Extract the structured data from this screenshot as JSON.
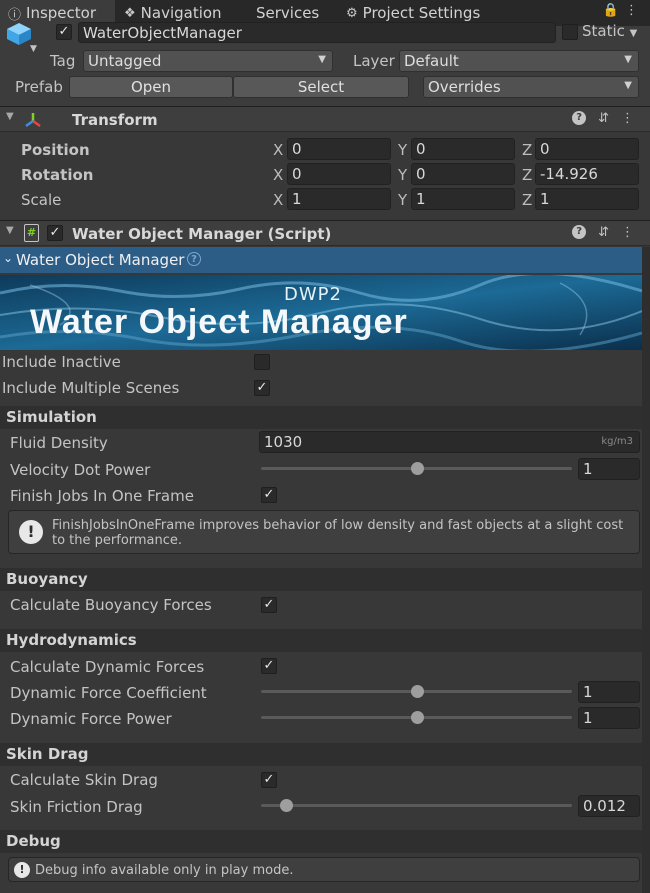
{
  "tabs": [
    {
      "label": "Inspector",
      "icon": "info-icon"
    },
    {
      "label": "Navigation",
      "icon": "compass-icon"
    },
    {
      "label": "Services",
      "icon": ""
    },
    {
      "label": "Project Settings",
      "icon": "gear-icon"
    }
  ],
  "object": {
    "name": "WaterObjectManager",
    "static_label": "Static",
    "tag_label": "Tag",
    "tag_value": "Untagged",
    "layer_label": "Layer",
    "layer_value": "Default",
    "prefab_label": "Prefab",
    "prefab_open": "Open",
    "prefab_select": "Select",
    "prefab_overrides": "Overrides"
  },
  "transform": {
    "title": "Transform",
    "rows": [
      {
        "label": "Position",
        "x": "0",
        "y": "0",
        "z": "0"
      },
      {
        "label": "Rotation",
        "x": "0",
        "y": "0",
        "z": "-14.926"
      },
      {
        "label": "Scale",
        "x": "1",
        "y": "1",
        "z": "1"
      }
    ],
    "axis_x": "X",
    "axis_y": "Y",
    "axis_z": "Z"
  },
  "script": {
    "title": "Water Object Manager (Script)",
    "foldout": "Water Object Manager",
    "banner_top": "DWP2",
    "banner_title": "Water Object Manager",
    "include_inactive": "Include Inactive",
    "include_multiple_scenes": "Include Multiple Scenes",
    "include_inactive_checked": false,
    "include_multiple_scenes_checked": true
  },
  "simulation": {
    "header": "Simulation",
    "fluid_density_label": "Fluid Density",
    "fluid_density_value": "1030",
    "fluid_density_unit": "kg/m3",
    "velocity_dot_power_label": "Velocity Dot Power",
    "velocity_dot_power_value": "1",
    "velocity_dot_power_level": 0.5,
    "finish_jobs_label": "Finish Jobs In One Frame",
    "finish_jobs_checked": true,
    "help_text": "FinishJobsInOneFrame improves behavior of low density and fast objects at a slight cost to the performance."
  },
  "buoyancy": {
    "header": "Buoyancy",
    "calc_label": "Calculate Buoyancy Forces",
    "calc_checked": true
  },
  "hydrodynamics": {
    "header": "Hydrodynamics",
    "calc_label": "Calculate Dynamic Forces",
    "calc_checked": true,
    "coef_label": "Dynamic Force Coefficient",
    "coef_value": "1",
    "coef_level": 0.5,
    "power_label": "Dynamic Force Power",
    "power_value": "1",
    "power_level": 0.5
  },
  "skin_drag": {
    "header": "Skin Drag",
    "calc_label": "Calculate Skin Drag",
    "calc_checked": true,
    "friction_label": "Skin Friction Drag",
    "friction_value": "0.012",
    "friction_level": 0.08
  },
  "debug": {
    "header": "Debug",
    "info": "Debug info available only in play mode."
  },
  "colors": {
    "selection": "#2c5d87",
    "panel": "#383838",
    "header": "#3e3e3e",
    "check": "#e8e8e8"
  }
}
